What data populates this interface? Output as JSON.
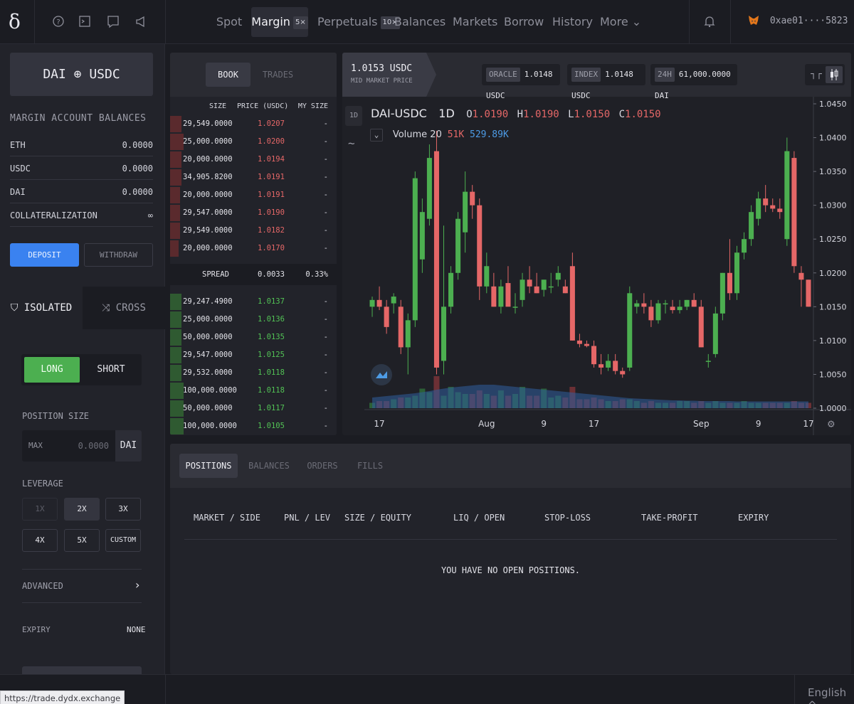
{
  "nav": {
    "logo": "δ",
    "items": [
      {
        "label": "Spot",
        "badge": ""
      },
      {
        "label": "Margin",
        "badge": "5×"
      },
      {
        "label": "Perpetuals",
        "badge": "10×"
      },
      {
        "label": "Balances",
        "badge": ""
      },
      {
        "label": "Markets",
        "badge": ""
      },
      {
        "label": "Borrow",
        "badge": ""
      },
      {
        "label": "History",
        "badge": ""
      },
      {
        "label": "More ⌄",
        "badge": ""
      }
    ],
    "active": "Margin",
    "wallet": "0xae01····5823",
    "icons": [
      "help-icon",
      "terminal-icon",
      "chat-icon",
      "megaphone-icon",
      "bell-icon",
      "metamask-fox-icon"
    ]
  },
  "sidebar": {
    "pair": "DAI ⊕ USDC",
    "balances_title": "MARGIN ACCOUNT BALANCES",
    "balances": [
      {
        "asset": "ETH",
        "value": "0.0000"
      },
      {
        "asset": "USDC",
        "value": "0.0000"
      },
      {
        "asset": "DAI",
        "value": "0.0000"
      },
      {
        "asset": "COLLATERALIZATION",
        "value": "∞"
      }
    ],
    "deposit": "DEPOSIT",
    "withdraw": "WITHDRAW",
    "tab_isolated": "ISOLATED",
    "tab_cross": "CROSS",
    "long": "LONG",
    "short": "SHORT",
    "position_size_label": "POSITION SIZE",
    "max": "MAX",
    "amount_placeholder": "0.0000",
    "currency": "DAI",
    "leverage_label": "LEVERAGE",
    "leverage_options": [
      "1X",
      "2X",
      "3X",
      "4X",
      "5X",
      "CUSTOM"
    ],
    "leverage_selected": "2X",
    "advanced": "ADVANCED",
    "expiry_label": "EXPIRY",
    "expiry_value": "NONE"
  },
  "book": {
    "tab_book": "BOOK",
    "tab_trades": "TRADES",
    "headers": {
      "size": "SIZE",
      "price": "PRICE (USDC)",
      "my_size": "MY SIZE"
    },
    "asks": [
      {
        "size": "29,549.0000",
        "price": "1.0207",
        "my": "-",
        "depth": 0.07
      },
      {
        "size": "25,000.0000",
        "price": "1.0200",
        "my": "-",
        "depth": 0.08
      },
      {
        "size": "20,000.0000",
        "price": "1.0194",
        "my": "-",
        "depth": 0.07
      },
      {
        "size": "34,905.8200",
        "price": "1.0191",
        "my": "-",
        "depth": 0.07
      },
      {
        "size": "20,000.0000",
        "price": "1.0191",
        "my": "-",
        "depth": 0.06
      },
      {
        "size": "29,547.0000",
        "price": "1.0190",
        "my": "-",
        "depth": 0.06
      },
      {
        "size": "29,549.0000",
        "price": "1.0182",
        "my": "-",
        "depth": 0.06
      },
      {
        "size": "20,000.0000",
        "price": "1.0170",
        "my": "-",
        "depth": 0.05
      }
    ],
    "spread_label": "SPREAD",
    "spread_value": "0.0033",
    "spread_pct": "0.33%",
    "bids": [
      {
        "size": "29,247.4900",
        "price": "1.0137",
        "my": "-",
        "depth": 0.07
      },
      {
        "size": "25,000.0000",
        "price": "1.0136",
        "my": "-",
        "depth": 0.07
      },
      {
        "size": "50,000.0000",
        "price": "1.0135",
        "my": "-",
        "depth": 0.07
      },
      {
        "size": "29,547.0000",
        "price": "1.0125",
        "my": "-",
        "depth": 0.07
      },
      {
        "size": "29,532.0000",
        "price": "1.0118",
        "my": "-",
        "depth": 0.07
      },
      {
        "size": "100,000.0000",
        "price": "1.0118",
        "my": "-",
        "depth": 0.08
      },
      {
        "size": "50,000.0000",
        "price": "1.0117",
        "my": "-",
        "depth": 0.08
      },
      {
        "size": "100,000.0000",
        "price": "1.0105",
        "my": "-",
        "depth": 0.08
      }
    ]
  },
  "chart_header": {
    "mid_price": "1.0153 USDC",
    "mid_label": "MID MARKET PRICE",
    "oracle_tag": "ORACLE",
    "oracle_value": "1.0148 USDC",
    "index_tag": "INDEX",
    "index_value": "1.0148 USDC",
    "vol_tag": "24H",
    "vol_value": "61,000.0000 DAI"
  },
  "chart_legend": {
    "symbol": "DAI-USDC",
    "interval": "1D",
    "o_label": "O",
    "o_value": "1.0190",
    "h_label": "H",
    "h_value": "1.0190",
    "l_label": "L",
    "l_value": "1.0150",
    "c_label": "C",
    "c_value": "1.0150",
    "volume_label": "Volume 20",
    "volume_value": "51K",
    "volume_ma": "529.89K",
    "toolbar_interval": "1D"
  },
  "chart_data": {
    "type": "candlestick",
    "y_ticks": [
      "1.0450",
      "1.0400",
      "1.0350",
      "1.0300",
      "1.0250",
      "1.0200",
      "1.0150",
      "1.0100",
      "1.0050",
      "1.0000"
    ],
    "ylim": [
      1.0,
      1.045
    ],
    "x_ticks": [
      {
        "label": "17",
        "index": 1
      },
      {
        "label": "Aug",
        "index": 16
      },
      {
        "label": "9",
        "index": 24
      },
      {
        "label": "17",
        "index": 31
      },
      {
        "label": "Sep",
        "index": 46
      },
      {
        "label": "9",
        "index": 54
      },
      {
        "label": "17",
        "index": 61
      }
    ],
    "candles": [
      [
        1.015,
        1.0165,
        1.0135,
        1.016
      ],
      [
        1.016,
        1.018,
        1.0145,
        1.015
      ],
      [
        1.015,
        1.016,
        1.011,
        1.012
      ],
      [
        1.0155,
        1.017,
        1.014,
        1.0165
      ],
      [
        1.015,
        1.016,
        1.008,
        1.009
      ],
      [
        1.009,
        1.014,
        1.005,
        1.013
      ],
      [
        1.013,
        1.035,
        1.012,
        1.034
      ],
      [
        1.022,
        1.031,
        1.02,
        1.029
      ],
      [
        1.028,
        1.039,
        1.027,
        1.037
      ],
      [
        1.038,
        1.041,
        1.005,
        1.006
      ],
      [
        1.007,
        1.027,
        1.005,
        1.015
      ],
      [
        1.015,
        1.021,
        1.014,
        1.02
      ],
      [
        1.02,
        1.029,
        1.019,
        1.028
      ],
      [
        1.026,
        1.035,
        1.023,
        1.032
      ],
      [
        1.032,
        1.033,
        1.028,
        1.03
      ],
      [
        1.03,
        1.031,
        1.016,
        1.018
      ],
      [
        1.018,
        1.023,
        1.017,
        1.021
      ],
      [
        1.018,
        1.02,
        1.015,
        1.015
      ],
      [
        1.015,
        1.019,
        1.014,
        1.018
      ],
      [
        1.0185,
        1.021,
        1.017,
        1.015
      ],
      [
        1.015,
        1.017,
        1.014,
        1.015
      ],
      [
        1.016,
        1.02,
        1.015,
        1.019
      ],
      [
        1.019,
        1.021,
        1.017,
        1.018
      ],
      [
        1.018,
        1.02,
        1.017,
        1.017
      ],
      [
        1.0175,
        1.019,
        1.0165,
        1.019
      ],
      [
        1.018,
        1.02,
        1.017,
        1.018
      ],
      [
        1.019,
        1.021,
        1.018,
        1.02
      ],
      [
        1.018,
        1.019,
        1.017,
        1.017
      ],
      [
        1.021,
        1.023,
        1.01,
        1.01
      ],
      [
        1.01,
        1.011,
        1.009,
        1.0095
      ],
      [
        1.0095,
        1.01,
        1.009,
        1.0092
      ],
      [
        1.0092,
        1.01,
        1.006,
        1.0065
      ],
      [
        1.0065,
        1.008,
        1.005,
        1.006
      ],
      [
        1.006,
        1.008,
        1.0055,
        1.007
      ],
      [
        1.007,
        1.008,
        1.005,
        1.0055
      ],
      [
        1.0055,
        1.006,
        1.0045,
        1.005
      ],
      [
        1.006,
        1.018,
        1.0055,
        1.017
      ],
      [
        1.015,
        1.016,
        1.014,
        1.0155
      ],
      [
        1.0155,
        1.017,
        1.014,
        1.015
      ],
      [
        1.015,
        1.016,
        1.012,
        1.013
      ],
      [
        1.013,
        1.016,
        1.0125,
        1.0155
      ],
      [
        1.0155,
        1.016,
        1.014,
        1.0155
      ],
      [
        1.015,
        1.016,
        1.014,
        1.0145
      ],
      [
        1.0145,
        1.016,
        1.014,
        1.015
      ],
      [
        1.015,
        1.016,
        1.0145,
        1.016
      ],
      [
        1.016,
        1.017,
        1.015,
        1.015
      ],
      [
        1.015,
        1.016,
        1.009,
        1.009
      ],
      [
        1.007,
        1.008,
        1.006,
        1.007
      ],
      [
        1.008,
        1.015,
        1.0075,
        1.014
      ],
      [
        1.014,
        1.02,
        1.013,
        1.02
      ],
      [
        1.02,
        1.025,
        1.016,
        1.017
      ],
      [
        1.017,
        1.024,
        1.016,
        1.023
      ],
      [
        1.023,
        1.026,
        1.022,
        1.025
      ],
      [
        1.025,
        1.03,
        1.024,
        1.029
      ],
      [
        1.028,
        1.032,
        1.027,
        1.031
      ],
      [
        1.031,
        1.033,
        1.029,
        1.03
      ],
      [
        1.03,
        1.031,
        1.029,
        1.0295
      ],
      [
        1.0295,
        1.031,
        1.028,
        1.029
      ],
      [
        1.025,
        1.04,
        1.024,
        1.038
      ],
      [
        1.037,
        1.038,
        1.02,
        1.021
      ],
      [
        1.02,
        1.021,
        1.015,
        1.019
      ],
      [
        1.019,
        1.019,
        1.015,
        1.015
      ]
    ],
    "volumes": [
      0.15,
      0.2,
      0.2,
      0.25,
      0.3,
      0.3,
      0.35,
      0.55,
      0.45,
      0.9,
      0.35,
      0.6,
      0.45,
      0.4,
      0.4,
      0.5,
      0.4,
      0.35,
      0.5,
      0.35,
      0.4,
      0.6,
      0.35,
      0.35,
      0.55,
      0.3,
      0.35,
      0.3,
      0.6,
      0.25,
      0.25,
      0.3,
      0.25,
      0.2,
      0.2,
      0.25,
      0.25,
      0.2,
      0.15,
      0.2,
      0.15,
      0.15,
      0.15,
      0.2,
      0.2,
      0.15,
      0.2,
      0.15,
      0.2,
      0.15,
      0.15,
      0.15,
      0.2,
      0.15,
      0.15,
      0.15,
      0.15,
      0.15,
      0.15,
      0.2,
      0.15,
      0.15
    ],
    "volume_ma": [
      0.3,
      0.32,
      0.34,
      0.36,
      0.38,
      0.4,
      0.42,
      0.45,
      0.48,
      0.52,
      0.55,
      0.58,
      0.6,
      0.62,
      0.64,
      0.66,
      0.66,
      0.66,
      0.64,
      0.62,
      0.6,
      0.58,
      0.56,
      0.54,
      0.52,
      0.5,
      0.48,
      0.46,
      0.44,
      0.42,
      0.4,
      0.38,
      0.36,
      0.34,
      0.32,
      0.3,
      0.28,
      0.27,
      0.26,
      0.25,
      0.24,
      0.23,
      0.22,
      0.22,
      0.21,
      0.21,
      0.2,
      0.2,
      0.2,
      0.2,
      0.2,
      0.19,
      0.19,
      0.19,
      0.19,
      0.19,
      0.19,
      0.19,
      0.19,
      0.19,
      0.19,
      0.19
    ]
  },
  "positions": {
    "tabs": [
      "POSITIONS",
      "BALANCES",
      "ORDERS",
      "FILLS"
    ],
    "active": "POSITIONS",
    "columns": [
      "MARKET / SIDE",
      "PNL / LEV",
      "SIZE / EQUITY",
      "LIQ / OPEN",
      "STOP-LOSS",
      "TAKE-PROFIT",
      "EXPIRY"
    ],
    "empty": "YOU HAVE NO OPEN POSITIONS."
  },
  "footer": {
    "url": "https://trade.dydx.exchange",
    "language": "English ^"
  },
  "colors": {
    "up": "#4caf50",
    "down": "#e56767",
    "accent": "#3a82f0",
    "volume_ma": "#2f5f9e"
  }
}
